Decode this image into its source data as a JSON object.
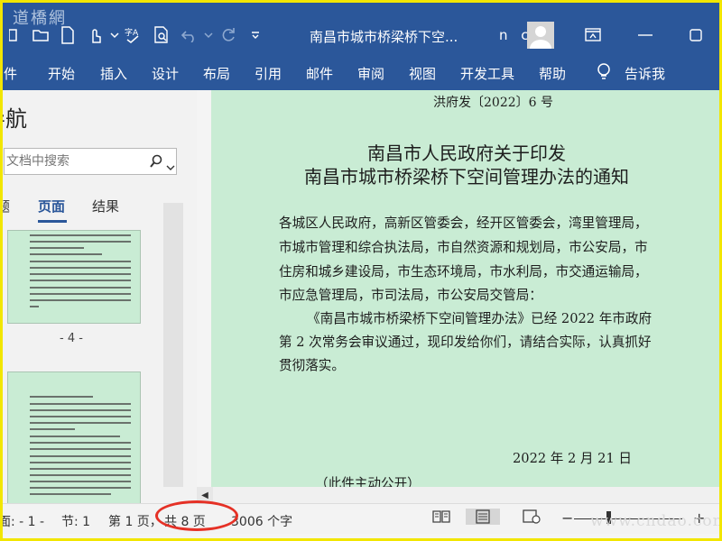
{
  "window": {
    "watermark": "道橋網",
    "doc_title": "南昌市城市桥梁桥下空...",
    "user_name": "n c"
  },
  "ribbon": {
    "tabs": [
      "件",
      "开始",
      "插入",
      "设计",
      "布局",
      "引用",
      "邮件",
      "审阅",
      "视图",
      "开发工具",
      "帮助",
      "告诉我"
    ]
  },
  "nav": {
    "title": "导航",
    "search_placeholder": "文档中搜索",
    "tabs": [
      "题",
      "页面",
      "结果"
    ],
    "thumb_page_label": "- 4 -"
  },
  "document": {
    "doc_number": "洪府发〔2022〕6 号",
    "heading_line1": "南昌市人民政府关于印发",
    "heading_line2": "南昌市城市桥梁桥下空间管理办法的通知",
    "para1": [
      "各城区人民政府，高新区管委会，经开区管委会，湾里管理局，",
      "市城市管理和综合执法局，市自然资源和规划局，市公安局，市",
      "住房和城乡建设局，市生态环境局，市水利局，市交通运输局，",
      "市应急管理局，市司法局，市公安局交管局："
    ],
    "para2": [
      "《南昌市城市桥梁桥下空间管理办法》已经 2022 年市政府",
      "第 2 次常务会审议通过，现印发给你们，请结合实际，认真抓好",
      "贯彻落实。"
    ],
    "date": "2022 年 2 月 21 日",
    "footer_note": "（此件主动公开）"
  },
  "status": {
    "page_of": "面: - 1 -",
    "section": "节: 1",
    "page_num": "第 1 页，",
    "total_pages": "共 8 页",
    "word_count": "3006 个字",
    "watermark": "www.cndao.com",
    "zoom_minus": "−",
    "zoom_plus": "+"
  },
  "colors": {
    "ribbon": "#2b579a",
    "page_bg": "#c9ecd4",
    "highlight_circle": "#e53126"
  }
}
